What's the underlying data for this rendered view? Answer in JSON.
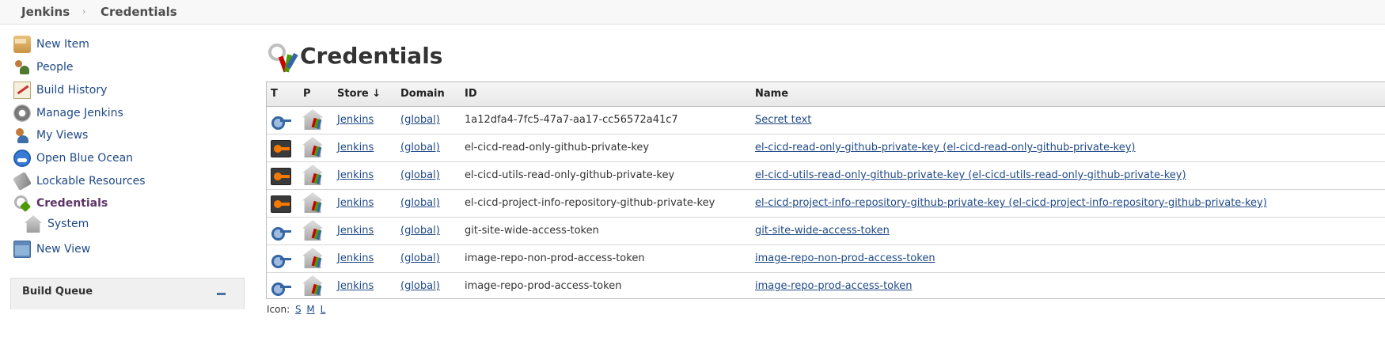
{
  "breadcrumb": {
    "home": "Jenkins",
    "current": "Credentials"
  },
  "sidebar": {
    "items": [
      {
        "label": "New Item",
        "icon": "new-item-icon"
      },
      {
        "label": "People",
        "icon": "people-icon"
      },
      {
        "label": "Build History",
        "icon": "build-history-icon"
      },
      {
        "label": "Manage Jenkins",
        "icon": "gear-icon"
      },
      {
        "label": "My Views",
        "icon": "user-icon"
      },
      {
        "label": "Open Blue Ocean",
        "icon": "blue-ocean-icon"
      },
      {
        "label": "Lockable Resources",
        "icon": "lock-icon"
      },
      {
        "label": "Credentials",
        "icon": "credentials-icon",
        "active": true
      },
      {
        "label": "System",
        "icon": "system-store-icon"
      },
      {
        "label": "New View",
        "icon": "folder-icon"
      }
    ]
  },
  "build_queue": {
    "title": "Build Queue"
  },
  "main": {
    "title": "Credentials",
    "table": {
      "headers": {
        "t": "T",
        "p": "P",
        "store": "Store ↓",
        "domain": "Domain",
        "id": "ID",
        "name": "Name"
      },
      "rows": [
        {
          "type": "secret-text",
          "store": "Jenkins",
          "domain": "(global)",
          "id": "1a12dfa4-7fc5-47a7-aa17-cc56572a41c7",
          "name": "Secret text"
        },
        {
          "type": "ssh-key",
          "store": "Jenkins",
          "domain": "(global)",
          "id": "el-cicd-read-only-github-private-key",
          "name": "el-cicd-read-only-github-private-key (el-cicd-read-only-github-private-key)"
        },
        {
          "type": "ssh-key",
          "store": "Jenkins",
          "domain": "(global)",
          "id": "el-cicd-utils-read-only-github-private-key",
          "name": "el-cicd-utils-read-only-github-private-key (el-cicd-utils-read-only-github-private-key)"
        },
        {
          "type": "ssh-key",
          "store": "Jenkins",
          "domain": "(global)",
          "id": "el-cicd-project-info-repository-github-private-key",
          "name": "el-cicd-project-info-repository-github-private-key (el-cicd-project-info-repository-github-private-key)"
        },
        {
          "type": "secret-text",
          "store": "Jenkins",
          "domain": "(global)",
          "id": "git-site-wide-access-token",
          "name": "git-site-wide-access-token"
        },
        {
          "type": "secret-text",
          "store": "Jenkins",
          "domain": "(global)",
          "id": "image-repo-non-prod-access-token",
          "name": "image-repo-non-prod-access-token"
        },
        {
          "type": "secret-text",
          "store": "Jenkins",
          "domain": "(global)",
          "id": "image-repo-prod-access-token",
          "name": "image-repo-prod-access-token"
        }
      ]
    },
    "icon_size": {
      "label": "Icon:",
      "options": [
        "S",
        "M",
        "L"
      ]
    }
  }
}
